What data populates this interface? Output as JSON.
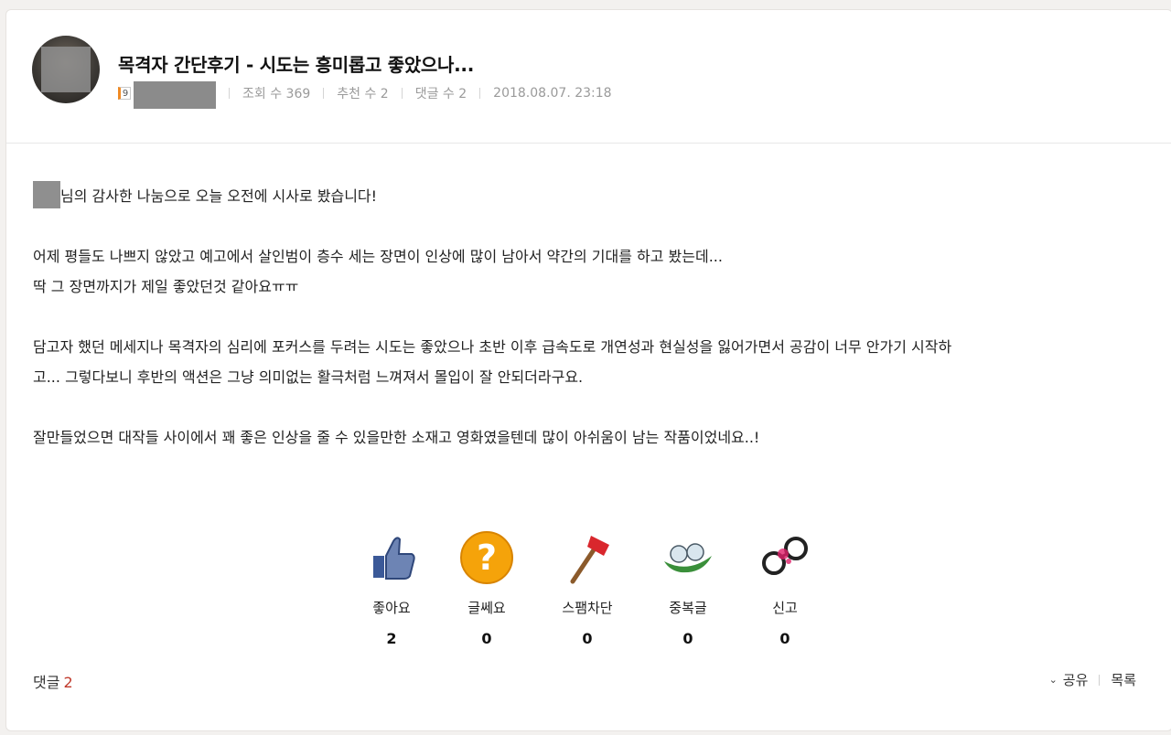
{
  "post": {
    "title": "목격자 간단후기 - 시도는 흥미롭고 좋았으나...",
    "level_badge": "9",
    "views_label": "조회 수 369",
    "recommend_label": "추천 수 2",
    "comment_count_label": "댓글 수 2",
    "datetime": "2018.08.07. 23:18"
  },
  "content": {
    "line1_suffix": "님의 감사한 나눔으로 오늘 오전에 시사로 봤습니다!",
    "line2": "어제 평들도 나쁘지 않았고 예고에서 살인범이 층수 세는 장면이 인상에 많이 남아서 약간의 기대를 하고 봤는데...",
    "line3": "딱 그 장면까지가 제일 좋았던것 같아요ㅠㅠ",
    "line4": "담고자 했던 메세지나 목격자의 심리에 포커스를 두려는 시도는 좋았으나 초반 이후 급속도로 개연성과 현실성을 잃어가면서 공감이 너무 안가기 시작하",
    "line5": "고... 그렇다보니 후반의 액션은 그냥 의미없는 활극처럼 느껴져서 몰입이 잘 안되더라구요.",
    "line6": "잘만들었으면 대작들 사이에서 꽤 좋은 인상을 줄 수 있을만한 소재고 영화였을텐데 많이 아쉬움이 남는 작품이었네요..!"
  },
  "reactions": [
    {
      "label": "좋아요",
      "count": "2",
      "icon": "thumbs-up-icon"
    },
    {
      "label": "글쎄요",
      "count": "0",
      "icon": "question-icon"
    },
    {
      "label": "스팸차단",
      "count": "0",
      "icon": "axe-icon"
    },
    {
      "label": "중복글",
      "count": "0",
      "icon": "duplicate-icon"
    },
    {
      "label": "신고",
      "count": "0",
      "icon": "handcuffs-icon"
    }
  ],
  "footer": {
    "comments_label": "댓글",
    "comments_count": "2",
    "share_label": "공유",
    "list_label": "목록"
  },
  "colors": {
    "accent_red": "#c0392b",
    "badge_orange": "#f08a24"
  }
}
